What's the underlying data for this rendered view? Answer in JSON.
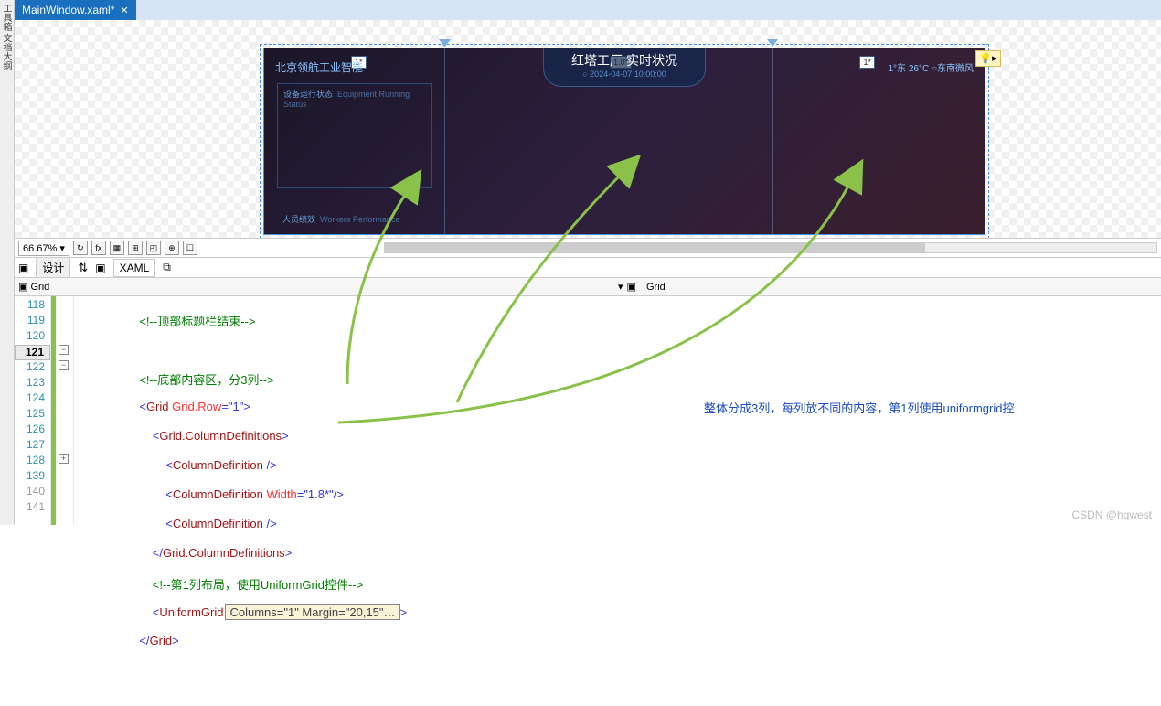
{
  "left_rail": {
    "labels": "工具箱 文档大纲"
  },
  "tab": {
    "title": "MainWindow.xaml*",
    "close": "✕"
  },
  "preview": {
    "left_text": "北京领航工业智能",
    "marker": "1*",
    "center_title": "红塔工厂    实时状况",
    "center_badge": "1.0*",
    "center_sub": "○ 2024-04-07 10:00:00",
    "right_text": "1°东    26°C  ○东南微风",
    "section1_cn": "设备运行状态",
    "section1_en": "Equipment Running Status",
    "section2_cn": "人员绩效",
    "section2_en": "Workers Performance",
    "bulb": "💡▸"
  },
  "zoom": {
    "value": "66.67%",
    "design_label": "设计",
    "xaml_label": "XAML"
  },
  "icons": {
    "fx": "fx",
    "refresh": "↻",
    "grid1": "▦",
    "grid2": "⊞",
    "snap": "◰",
    "target": "⊕",
    "box": "☐",
    "ext": "⧉"
  },
  "crumb": {
    "left": "Grid",
    "right": "Grid",
    "icon": "▣",
    "dd": "▾"
  },
  "lines": {
    "118": {
      "indent": 3,
      "text_comment": "<!--顶部标题栏结束-->"
    },
    "119": {
      "indent": 0,
      "text": ""
    },
    "120": {
      "indent": 3,
      "text_comment": "<!--底部内容区，分3列-->"
    },
    "121": {
      "indent": 3,
      "tag_open": "Grid",
      "attr": "Grid.Row",
      "val": "\"1\""
    },
    "122": {
      "indent": 4,
      "tag_open": "Grid.ColumnDefinitions"
    },
    "123": {
      "indent": 5,
      "tag_self": "ColumnDefinition"
    },
    "124": {
      "indent": 5,
      "tag_self": "ColumnDefinition",
      "attr": "Width",
      "val": "\"1.8*\""
    },
    "125": {
      "indent": 5,
      "tag_self": "ColumnDefinition"
    },
    "126": {
      "indent": 4,
      "tag_close": "Grid.ColumnDefinitions"
    },
    "127": {
      "indent": 4,
      "text_comment": "<!--第1列布局，使用UniformGrid控件-->"
    },
    "128": {
      "indent": 4,
      "tag_open_partial": "UniformGrid",
      "tooltip": "Columns=\"1\" Margin=\"20,15\"…"
    },
    "139": {
      "indent": 3,
      "tag_close": "Grid"
    },
    "140": {
      "indent": 0,
      "text": ""
    }
  },
  "annotation": {
    "text": "整体分成3列，每列放不同的内容，第1列使用uniformgrid控"
  },
  "watermark": "CSDN @hqwest"
}
